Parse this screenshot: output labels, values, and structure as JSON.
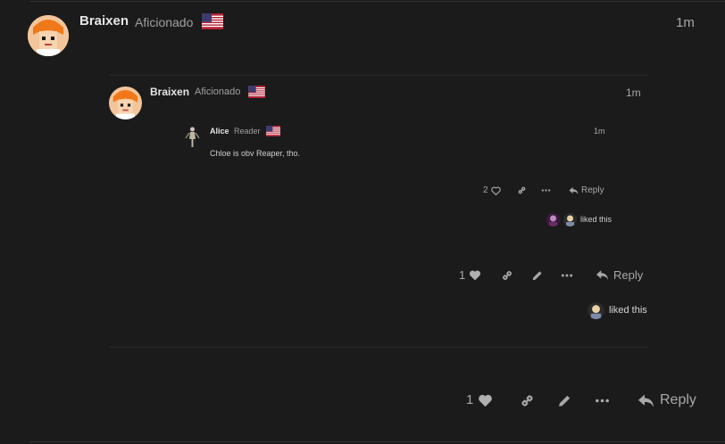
{
  "colors": {
    "background": "#1b1b1b",
    "text": "#d8d8d8",
    "muted": "#a0a0a0",
    "divider": "#2a2a2a"
  },
  "outer_post": {
    "username": "Braixen",
    "title": "Aficionado",
    "flag_icon": "us-flag-icon",
    "time": "1m",
    "likes": "1",
    "reply_label": "Reply"
  },
  "quote_level1": {
    "username": "Braixen",
    "title": "Aficionado",
    "flag_icon": "us-flag-icon",
    "time": "1m",
    "likes": "1",
    "reply_label": "Reply",
    "liked_this": "liked this"
  },
  "quote_level2": {
    "username": "Alice",
    "title": "Reader",
    "flag_icon": "us-flag-icon",
    "time": "1m",
    "body": "Chloe is obv Reaper, tho.",
    "likes": "2",
    "reply_label": "Reply",
    "liked_this": "liked this"
  }
}
